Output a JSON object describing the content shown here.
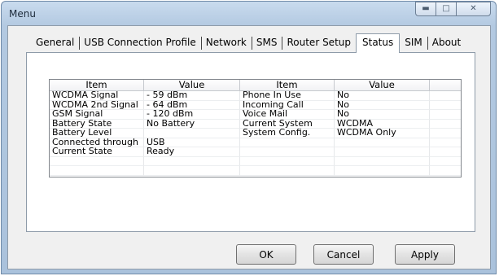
{
  "window": {
    "title": "Menu"
  },
  "tabs": [
    {
      "label": "General"
    },
    {
      "label": "USB Connection Profile"
    },
    {
      "label": "Network"
    },
    {
      "label": "SMS"
    },
    {
      "label": "Router Setup"
    },
    {
      "label": "Status"
    },
    {
      "label": "SIM"
    },
    {
      "label": "About"
    }
  ],
  "active_tab": "Status",
  "status_table": {
    "headers": [
      "Item",
      "Value",
      "Item",
      "Value"
    ],
    "rows": [
      [
        "WCDMA Signal",
        "- 59 dBm",
        "Phone In Use",
        "No"
      ],
      [
        "WCDMA 2nd Signal",
        "- 64 dBm",
        "Incoming Call",
        "No"
      ],
      [
        "GSM Signal",
        "- 120 dBm",
        "Voice Mail",
        "No"
      ],
      [
        "Battery State",
        "No Battery",
        "Current System",
        "WCDMA"
      ],
      [
        "Battery Level",
        "",
        "System Config.",
        "WCDMA Only"
      ],
      [
        "Connected through",
        "USB",
        "",
        ""
      ],
      [
        "Current State",
        "Ready",
        "",
        ""
      ],
      [
        "",
        "",
        "",
        ""
      ],
      [
        "",
        "",
        "",
        ""
      ]
    ]
  },
  "buttons": {
    "ok": "OK",
    "cancel": "Cancel",
    "apply": "Apply"
  }
}
